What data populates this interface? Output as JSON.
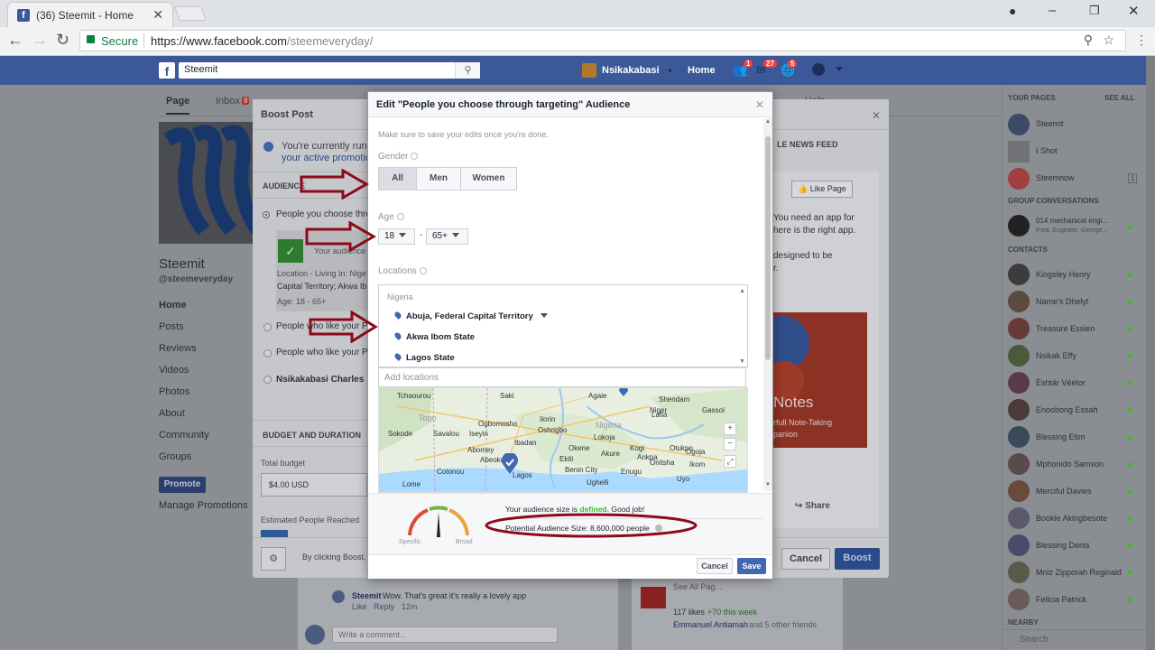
{
  "browser": {
    "tab_title": "(36) Steemit - Home",
    "secure_label": "Secure",
    "url_prefix": "https://www.facebook.com",
    "url_path": "/steemeveryday/"
  },
  "fb_header": {
    "search_value": "Steemit",
    "user_name": "Nsikakabasi",
    "home_label": "Home",
    "badges": [
      "1",
      "27",
      "5"
    ]
  },
  "page_tabs": {
    "page": "Page",
    "inbox": "Inbox",
    "inbox_count": "8",
    "help": "Help"
  },
  "page_left": {
    "name": "Steemit",
    "handle": "@steemeveryday",
    "nav": [
      "Home",
      "Posts",
      "Reviews",
      "Videos",
      "Photos",
      "About",
      "Community",
      "Groups"
    ],
    "promote_label": "Promote",
    "manage_label": "Manage Promotions"
  },
  "boost_dialog": {
    "title": "Boost Post",
    "notice_line1": "You're currently runn",
    "notice_line2": "your active promotio",
    "audience_label": "AUDIENCE",
    "option1": "People you choose thro",
    "summary_audience": "Your audience",
    "summary_location_1": "Location - Living In: Nige",
    "summary_location_2": "Capital Territory; Akwa Ib",
    "summary_age": "Age: 18 - 65+",
    "option2": "People who like your Pa",
    "option3": "People who like your Pa",
    "option4": "Nsikakabasi Charles",
    "budget_heading": "BUDGET AND DURATION",
    "total_budget_label": "Total budget",
    "total_budget_value": "$4.00 USD",
    "estimated_label": "Estimated People Reached",
    "terms_text": "By clicking Boost,",
    "right_heading": "LE NEWS FEED",
    "like_page": "Like Page",
    "preview_text_1": "You need an app for",
    "preview_text_2": "here is the right app.",
    "preview_text_3": "designed to be",
    "preview_text_4": "r.",
    "notes_title": "Notes",
    "notes_sub_1": "rfull Note-Taking",
    "notes_sub_2": "panion",
    "share_label": "Share",
    "cancel_label": "Cancel",
    "boost_label": "Boost"
  },
  "modal": {
    "title": "Edit \"People you choose through targeting\" Audience",
    "hint": "Make sure to save your edits once you're done.",
    "gender_label": "Gender",
    "gender_options": [
      "All",
      "Men",
      "Women"
    ],
    "gender_selected": "All",
    "age_label": "Age",
    "age_min": "18",
    "age_dash": "-",
    "age_max": "65+",
    "locations_label": "Locations",
    "country": "Nigeria",
    "locations": [
      "Abuja, Federal Capital Territory",
      "Akwa Ibom State",
      "Lagos State"
    ],
    "add_locations_placeholder": "Add locations",
    "map_labels": [
      "Tchaourou",
      "Saki",
      "Agaie",
      "Shendam",
      "Niger",
      "Togo",
      "Ogbomosho",
      "Ilorin",
      "Nigeria",
      "Lafia",
      "Gassol",
      "Sokode",
      "Savalou",
      "Iseyin",
      "Ibadan",
      "Lokoja",
      "Kogi",
      "Oshogbo",
      "Abomey",
      "Abeokuta",
      "Akure",
      "Okene",
      "Ankpa",
      "Otukpo",
      "Lagos",
      "Benin City",
      "Enugu",
      "Lome",
      "Ughelli",
      "Onitsha",
      "Ogoja",
      "Ikom",
      "Ekiti",
      "Cotonou",
      "Uyo"
    ],
    "audience_status_pre": "Your audience size is",
    "audience_status_word": "defined.",
    "audience_status_post": "Good job!",
    "potential_size": "Potential Audience Size: 8,600,000 people",
    "gauge_specific": "Specific",
    "gauge_broad": "Broad",
    "cancel_label": "Cancel",
    "save_label": "Save"
  },
  "right_sidebar": {
    "your_pages_label": "YOUR PAGES",
    "see_all": "SEE ALL",
    "pages": [
      "Steemit",
      "I Shot",
      "Steemnow"
    ],
    "steemnow_count": "1",
    "group_label": "GROUP CONVERSATIONS",
    "group_name": "014 mechanical engi...",
    "group_members": "Fred, Engineer, George...",
    "contacts_label": "CONTACTS",
    "contacts": [
      "Kingsley Henry",
      "Name's Dhelyt",
      "Treasure Essien",
      "Nsikak Effy",
      "Èshtár Véétor",
      "Enoobong Essah",
      "Blessing Etim",
      "Mphonido Samson",
      "Merciful Davies",
      "Bookie Akingbesote",
      "Blessing Denis",
      "Mniz Zipporah Reginald",
      "Felicia Patrick"
    ],
    "nearby_label": "NEARBY",
    "search_placeholder": "Search"
  },
  "feed": {
    "comment_author": "Steemit",
    "comment_text": "Wow. That's great it's really a lovely app",
    "comment_meta_like": "Like",
    "comment_meta_reply": "Reply",
    "comment_meta_time": "12m",
    "write_comment": "Write a comment...",
    "likes_text": "117 likes",
    "this_week": "+70 this week",
    "friends_text": "Emmanuel Antiamah",
    "friends_suffix": "and 5 other friends",
    "see_all_text": "See All Pag..."
  },
  "colors": {
    "fb_blue": "#3b5998",
    "save_blue": "#4267b2",
    "defined_green": "#42b72a",
    "annotation_red": "#8b0a1a"
  }
}
